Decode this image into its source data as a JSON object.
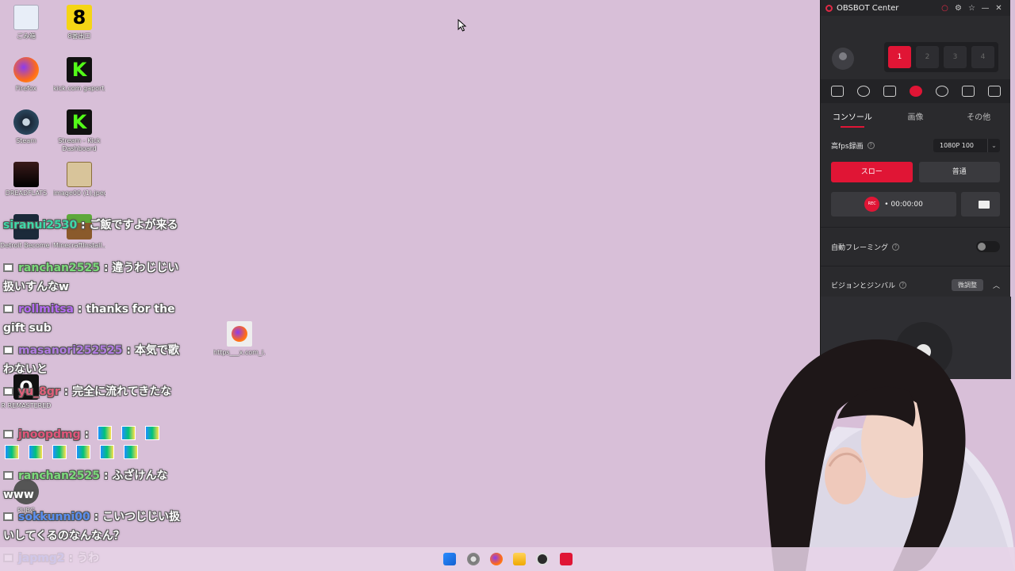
{
  "desktop": {
    "icons": [
      {
        "label": "ごみ箱",
        "icon": "recycle-bin-icon"
      },
      {
        "label": "8番出口",
        "icon": "exit8-icon"
      },
      {
        "label": "Firefox",
        "icon": "firefox-icon"
      },
      {
        "label": "kick.com gaport...",
        "icon": "kick-icon"
      },
      {
        "label": "Steam",
        "icon": "steam-icon"
      },
      {
        "label": "Stream - Kick Dashboard",
        "icon": "kick-icon"
      },
      {
        "label": "DREADFLATS",
        "icon": "game-icon"
      },
      {
        "label": "image00 (1).jpeg",
        "icon": "image-file-icon"
      },
      {
        "label": "Detroit Become Human",
        "icon": "game-icon"
      },
      {
        "label": "MinecraftInstall...",
        "icon": "minecraft-icon"
      },
      {
        "label": "https___x.com_i...",
        "icon": "firefox-shortcut-icon"
      },
      {
        "label": "R REMASTERED",
        "icon": "quake-icon"
      },
      {
        "label": "PUBG",
        "icon": "game-icon"
      }
    ]
  },
  "chat": {
    "messages": [
      {
        "user": "siranui2530",
        "sep": " : ",
        "text": "ご飯ですよが来る",
        "user_color": "#3dd9a8"
      },
      {
        "user": "ranchan2525",
        "sep": " : ",
        "text": "違うわじじい扱いすんなw",
        "user_color": "#7bd97a"
      },
      {
        "user": "rollmitsa",
        "sep": " : ",
        "text": "thanks for the gift sub",
        "user_color": "#b46bf0"
      },
      {
        "user": "masanori252525",
        "sep": " : ",
        "text": "本気で歌わないと",
        "user_color": "#b07be0"
      },
      {
        "user": "yu_8gr",
        "sep": " : ",
        "text": "完全に流れてきたな",
        "user_color": "#e0607a"
      },
      {
        "user": "jnoopdmg",
        "sep": " : ",
        "text": "",
        "user_color": "#e0557a",
        "emotes": 10
      },
      {
        "user": "ranchan2525",
        "sep": " : ",
        "text": "ふざけんなwww",
        "user_color": "#7bd97a"
      },
      {
        "user": "sokkunni00",
        "sep": " : ",
        "text": "こいつじじい扱いしてくるのなんなん？",
        "user_color": "#5b8ff0"
      },
      {
        "user": "japmg2",
        "sep": " : ",
        "text": "うわ",
        "user_color": "#4b7fe8"
      }
    ]
  },
  "obsbot": {
    "title": "OBSBOT Center",
    "slots": [
      "1",
      "2",
      "3",
      "4"
    ],
    "tabs": [
      "コンソール",
      "画像",
      "その他"
    ],
    "hfps_label": "高fps録画",
    "resolution": "1080P 100",
    "slow_label": "スロー",
    "normal_label": "普通",
    "rec_badge": "REC",
    "rec_time": "• 00:00:00",
    "auto_framing_label": "自動フレーミング",
    "gimbal_label": "ビジョンとジンバル",
    "fine_tune_label": "微調整",
    "accent": "#e01535"
  }
}
